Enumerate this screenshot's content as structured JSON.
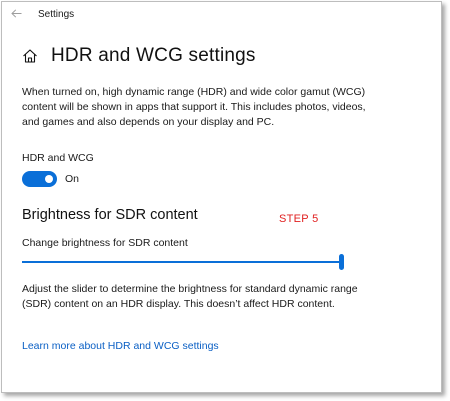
{
  "window": {
    "title": "Settings"
  },
  "page": {
    "title": "HDR and WCG settings",
    "description": "When turned on, high dynamic range (HDR) and wide color gamut (WCG) content will be shown in apps that support it. This includes photos, videos, and games and also depends on your display and PC."
  },
  "hdr_toggle": {
    "label": "HDR and WCG",
    "state_text": "On",
    "on": true
  },
  "sdr_section": {
    "title": "Brightness for SDR content",
    "annotation": "STEP 5",
    "slider_label": "Change brightness for SDR content",
    "slider_value": 1.0,
    "help_text": "Adjust the slider to determine the brightness for standard dynamic range (SDR) content on an HDR display. This doesn’t affect HDR content."
  },
  "links": {
    "learn_more": "Learn more about HDR and WCG settings"
  },
  "icons": {
    "back": "back-arrow-icon",
    "home": "home-icon"
  },
  "colors": {
    "accent": "#0a6fd8",
    "link": "#0a5fc4",
    "annotation": "#e02020"
  }
}
